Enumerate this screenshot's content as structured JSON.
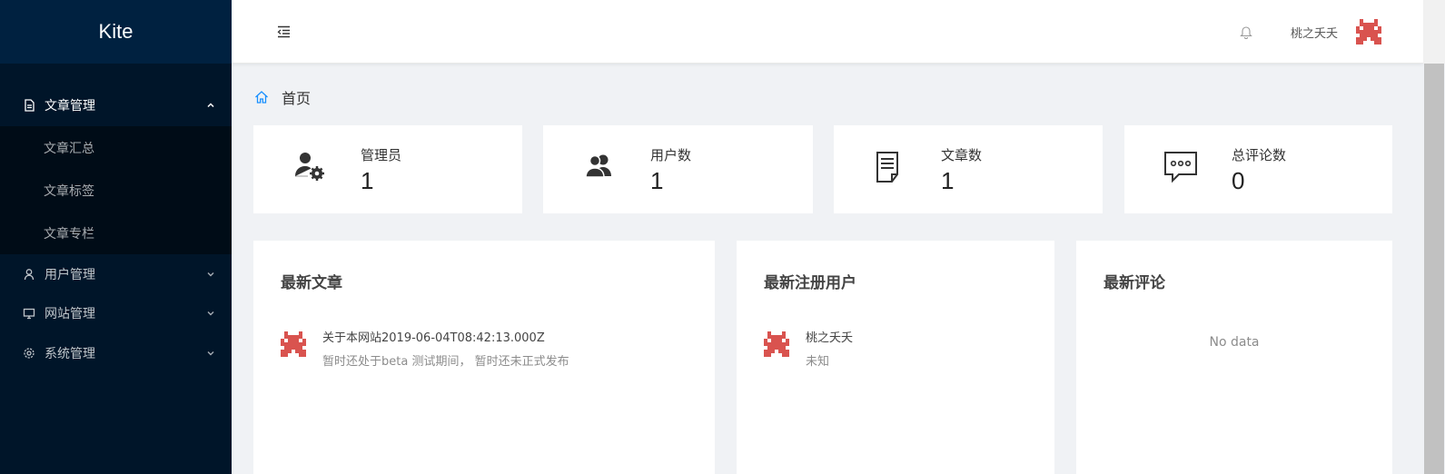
{
  "app": {
    "logo": "Kite"
  },
  "sidebar": {
    "menus": [
      {
        "label": "文章管理",
        "icon": "file-icon",
        "open": true,
        "children": [
          {
            "label": "文章汇总"
          },
          {
            "label": "文章标签"
          },
          {
            "label": "文章专栏"
          }
        ]
      },
      {
        "label": "用户管理",
        "icon": "user-icon",
        "open": false
      },
      {
        "label": "网站管理",
        "icon": "desktop-icon",
        "open": false
      },
      {
        "label": "系统管理",
        "icon": "gear-icon",
        "open": false
      }
    ]
  },
  "header": {
    "username": "桃之夭夭"
  },
  "breadcrumb": {
    "home": "首页"
  },
  "stats": [
    {
      "label": "管理员",
      "value": "1",
      "icon": "admin-gear-icon"
    },
    {
      "label": "用户数",
      "value": "1",
      "icon": "users-icon"
    },
    {
      "label": "文章数",
      "value": "1",
      "icon": "document-icon"
    },
    {
      "label": "总评论数",
      "value": "0",
      "icon": "comment-icon"
    }
  ],
  "panels": {
    "articles": {
      "title": "最新文章",
      "items": [
        {
          "title": "关于本网站2019-06-04T08:42:13.000Z",
          "desc": "暂时还处于beta 测试期间， 暂时还未正式发布"
        }
      ]
    },
    "users": {
      "title": "最新注册用户",
      "items": [
        {
          "name": "桃之夭夭",
          "desc": "未知"
        }
      ]
    },
    "comments": {
      "title": "最新评论",
      "empty_text": "No data"
    }
  },
  "colors": {
    "sidebar_bg": "#001529",
    "logo_bg": "#002140",
    "submenu_bg": "#000c17",
    "avatar_red": "#d9534f",
    "accent_blue": "#1890ff"
  }
}
